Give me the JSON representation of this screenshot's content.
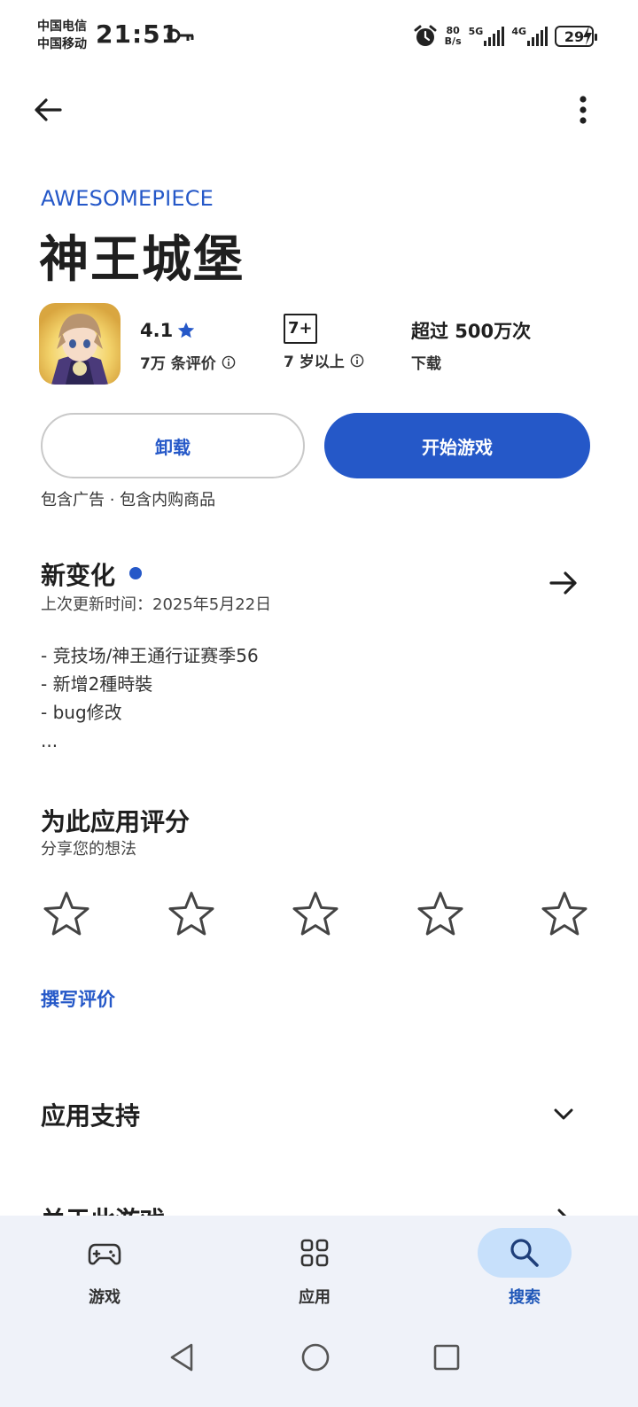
{
  "status_bar": {
    "carrier_1": "中国电信",
    "carrier_2": "中国移动",
    "time": "21:51",
    "net_speed_value": "80",
    "net_speed_unit": "B/s",
    "network_1": "5G",
    "network_2": "4G",
    "battery": "29"
  },
  "app": {
    "developer": "AWESOMEPIECE",
    "title": "神王城堡",
    "rating": "4.1",
    "reviews": "7万 条评价",
    "age_badge": "7+",
    "age_label": "7 岁以上",
    "downloads": "超过 500万次",
    "downloads_label": "下载"
  },
  "actions": {
    "uninstall": "卸载",
    "play": "开始游戏",
    "contains": "包含广告 · 包含内购商品"
  },
  "whats_new": {
    "title": "新变化",
    "updated": "上次更新时间：2025年5月22日",
    "notes": [
      "- 竞技场/神王通行证赛季56",
      "- 新增2種時裝",
      "- bug修改",
      "..."
    ]
  },
  "rate": {
    "title": "为此应用评分",
    "subtitle": "分享您的想法",
    "write_review": "撰写评价"
  },
  "support": {
    "title": "应用支持"
  },
  "about": {
    "title": "关于此游戏"
  },
  "bottom_nav": {
    "items": [
      {
        "label": "游戏"
      },
      {
        "label": "应用"
      },
      {
        "label": "搜索"
      }
    ],
    "active": "搜索"
  },
  "colors": {
    "accent": "#2558c8",
    "nav_active_bg": "#c7e0fb",
    "nav_bg": "#eff2f9"
  }
}
